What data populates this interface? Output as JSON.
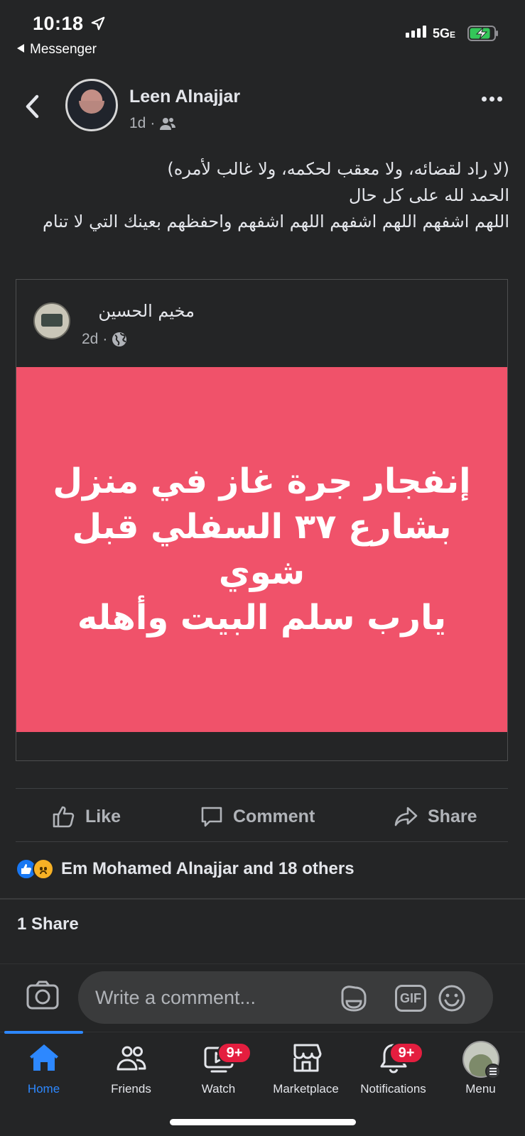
{
  "status_bar": {
    "time": "10:18",
    "back_app": "Messenger",
    "network": "5G",
    "network_suffix": "E",
    "icons": [
      "location-arrow-icon",
      "signal-icon",
      "battery-charging-icon"
    ]
  },
  "post": {
    "author": "Leen Alnajjar",
    "time": "1d",
    "audience_icon": "friends-icon",
    "text_lines": [
      "(لا راد لقضائه، ولا معقب لحكمه، ولا غالب لأمره)",
      "الحمد لله على كل حال",
      "اللهم اشفهم اللهم اشفهم اللهم اشفهم واحفظهم بعينك التي لا تنام"
    ]
  },
  "shared_post": {
    "page_name": "مخيم الحسين",
    "time": "2d",
    "audience_icon": "globe-icon",
    "banner_text": "إنفجار جرة غاز في منزل\nبشارع ٣٧ السفلي قبل\nشوي\nيارب سلم البيت وأهله",
    "banner_color": "#f0526a"
  },
  "actions": {
    "like": "Like",
    "comment": "Comment",
    "share": "Share"
  },
  "reactions": {
    "icons": [
      "like-reaction-icon",
      "sad-reaction-icon"
    ],
    "text": "Em Mohamed Alnajjar and 18 others"
  },
  "shares_text": "1 Share",
  "comment_box": {
    "placeholder": "Write a comment...",
    "gif_label": "GIF"
  },
  "tabs": [
    {
      "label": "Home",
      "icon": "home-icon",
      "active": true
    },
    {
      "label": "Friends",
      "icon": "friends-icon"
    },
    {
      "label": "Watch",
      "icon": "watch-icon",
      "badge": "9+"
    },
    {
      "label": "Marketplace",
      "icon": "marketplace-icon"
    },
    {
      "label": "Notifications",
      "icon": "bell-icon",
      "badge": "9+"
    },
    {
      "label": "Menu",
      "icon": "menu-avatar"
    }
  ],
  "colors": {
    "background": "#242526",
    "accent": "#2d88ff",
    "badge": "#e41e3f",
    "text_secondary": "#b0b3b8"
  }
}
